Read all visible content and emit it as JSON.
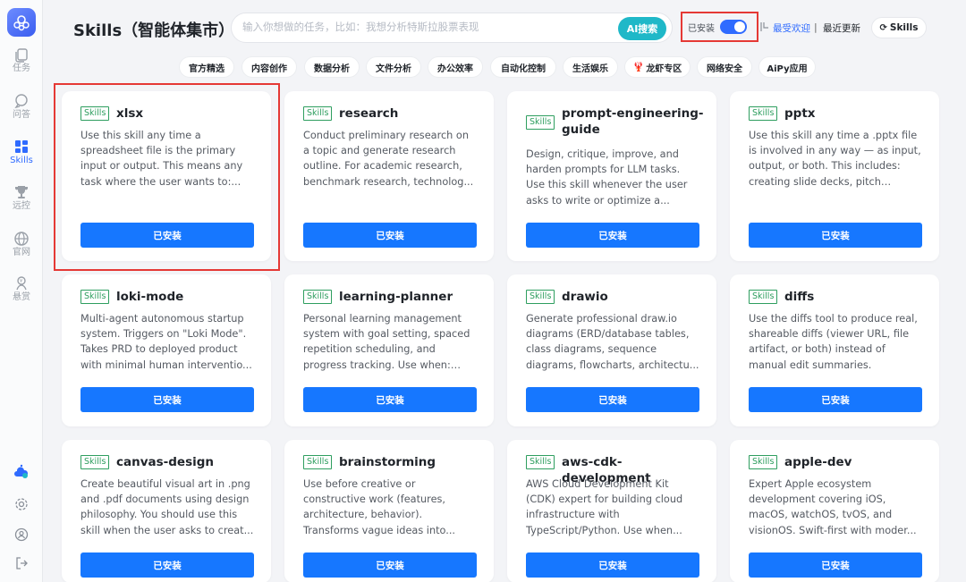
{
  "sidebar": {
    "items": [
      {
        "label": "任务",
        "icon": "copy-icon",
        "active": false
      },
      {
        "label": "问答",
        "icon": "chat-bubble-icon",
        "active": false
      },
      {
        "label": "Skills",
        "icon": "grid-blocks-icon",
        "active": true
      },
      {
        "label": "远控",
        "icon": "trophy-icon",
        "active": false
      },
      {
        "label": "官网",
        "icon": "globe-icon",
        "active": false
      },
      {
        "label": "悬赏",
        "icon": "reward-icon",
        "active": false
      }
    ],
    "utilities": [
      "cloud-sync-icon",
      "settings-icon",
      "user-icon",
      "logout-icon"
    ]
  },
  "header": {
    "title": "Skills（智能体集市）",
    "search_placeholder": "输入你想做的任务，比如：我想分析特斯拉股票表现",
    "ai_search_label": "AI搜索",
    "installed_filter_label": "已安装",
    "installed_filter_on": true,
    "sort_popular": "最受欢迎",
    "sort_separator": "|",
    "sort_recent": "最近更新",
    "skills_button_label": "Skills"
  },
  "categories": [
    "官方精选",
    "内容创作",
    "数据分析",
    "文件分析",
    "办公效率",
    "自动化控制",
    "生活娱乐",
    "龙虾专区",
    "网络安全",
    "AiPy应用"
  ],
  "tag_label": "Skills",
  "install_label": "已安装",
  "cards": [
    {
      "name": "xlsx",
      "desc": "Use this skill any time a spreadsheet file is the primary input or output. This means any task where the user wants to:..."
    },
    {
      "name": "research",
      "desc": "Conduct preliminary research on a topic and generate research outline. For academic research, benchmark research, technolog..."
    },
    {
      "name": "prompt-engineering-guide",
      "desc": "Design, critique, improve, and harden prompts for LLM tasks. Use this skill whenever the user asks to write or optimize a..."
    },
    {
      "name": "pptx",
      "desc": "Use this skill any time a .pptx file is involved in any way — as input, output, or both. This includes: creating slide decks, pitch decks..."
    },
    {
      "name": "loki-mode",
      "desc": "Multi-agent autonomous startup system. Triggers on \"Loki Mode\". Takes PRD to deployed product with minimal human interventio..."
    },
    {
      "name": "learning-planner",
      "desc": "Personal learning management system with goal setting, spaced repetition scheduling, and progress tracking. Use when: (1)..."
    },
    {
      "name": "drawio",
      "desc": "Generate professional draw.io diagrams (ERD/database tables, class diagrams, sequence diagrams, flowcharts, architectu..."
    },
    {
      "name": "diffs",
      "desc": "Use the diffs tool to produce real, shareable diffs (viewer URL, file artifact, or both) instead of manual edit summaries."
    },
    {
      "name": "canvas-design",
      "desc": "Create beautiful visual art in .png and .pdf documents using design philosophy. You should use this skill when the user asks to creat..."
    },
    {
      "name": "brainstorming",
      "desc": "Use before creative or constructive work (features, architecture, behavior). Transforms vague ideas into..."
    },
    {
      "name": "aws-cdk-development",
      "desc": "AWS Cloud Development Kit (CDK) expert for building cloud infrastructure with TypeScript/Python. Use when..."
    },
    {
      "name": "apple-dev",
      "desc": "Expert Apple ecosystem development covering iOS, macOS, watchOS, tvOS, and visionOS. Swift-first with moder..."
    }
  ],
  "colors": {
    "accent": "#1677ff",
    "active_nav": "#2f6bff",
    "ai_search": "#1fb8c8",
    "tag_green": "#2e9e5f",
    "highlight_red": "#e53935"
  }
}
